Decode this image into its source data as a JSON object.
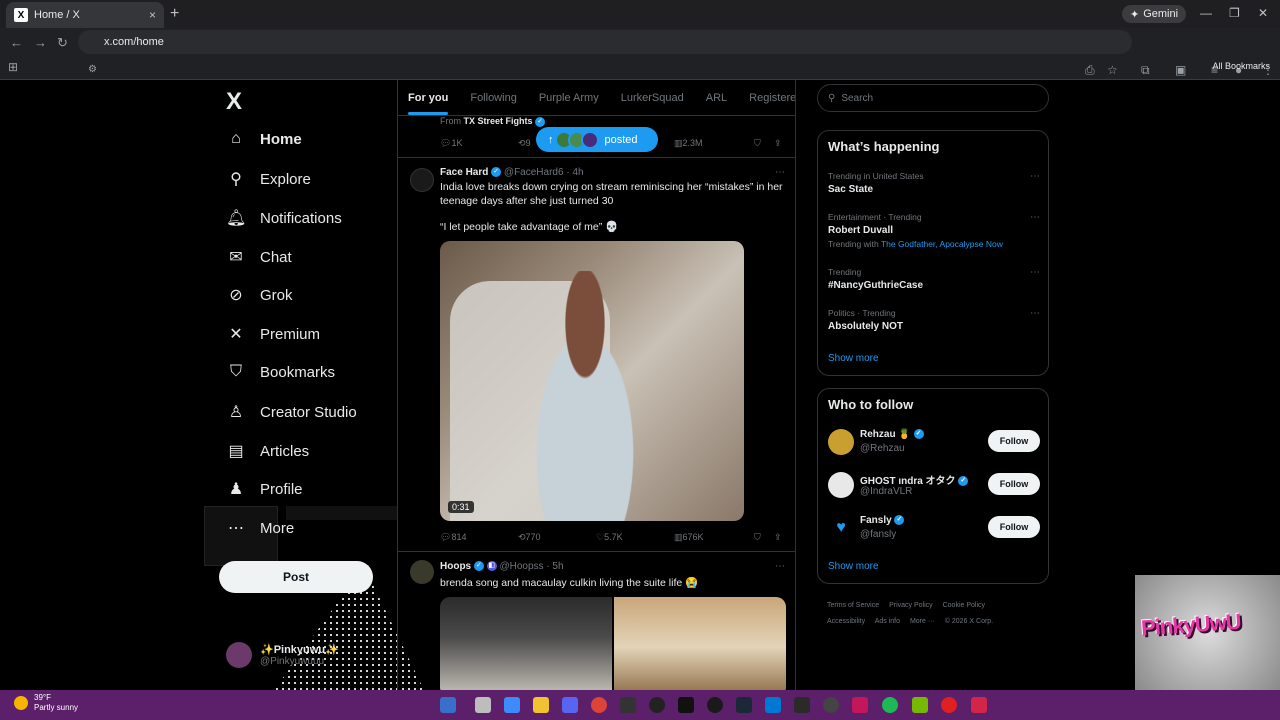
{
  "browser": {
    "tab_title": "Home / X",
    "tab_favicon": "X",
    "tab_close": "×",
    "new_tab": "+",
    "gemini_label": "Gemini",
    "url": "x.com/home",
    "all_bookmarks": "All Bookmarks"
  },
  "nav": {
    "logo": "X",
    "items": [
      {
        "label": "Home",
        "icon": "home-icon",
        "glyph": "⌂"
      },
      {
        "label": "Explore",
        "icon": "search-icon",
        "glyph": "⚲"
      },
      {
        "label": "Notifications",
        "icon": "bell-icon",
        "glyph": "🔔︎"
      },
      {
        "label": "Chat",
        "icon": "mail-icon",
        "glyph": "✉"
      },
      {
        "label": "Grok",
        "icon": "grok-icon",
        "glyph": "⊘"
      },
      {
        "label": "Premium",
        "icon": "x-icon",
        "glyph": "✕"
      },
      {
        "label": "Bookmarks",
        "icon": "bookmark-icon",
        "glyph": "⛉"
      },
      {
        "label": "Creator Studio",
        "icon": "creator-icon",
        "glyph": "♙"
      },
      {
        "label": "Articles",
        "icon": "articles-icon",
        "glyph": "▤"
      },
      {
        "label": "Profile",
        "icon": "profile-icon",
        "glyph": "♟"
      },
      {
        "label": "More",
        "icon": "more-icon",
        "glyph": "⋯"
      }
    ],
    "post_button": "Post",
    "account": {
      "name": "✨Pinkyuwu✨",
      "handle": "@Pinkyuwuuu"
    }
  },
  "feed": {
    "tabs": [
      "For you",
      "Following",
      "Purple Army",
      "LurkerSquad",
      "ARL",
      "Registered Fle"
    ],
    "prev_tweet": {
      "from_label": "From",
      "from_name": "TX Street Fights",
      "replies": "1K",
      "retweets": "9",
      "views": "2.3M"
    },
    "new_posts_pill": "posted",
    "tweet1": {
      "name": "Face Hard",
      "handle": "@FaceHard6",
      "time": "4h",
      "text": "India love breaks down crying on stream reminiscing her “mistakes” in her teenage days after she just turned 30",
      "quote": "“I let people take advantage of me” 💀",
      "duration": "0:31",
      "replies": "814",
      "retweets": "770",
      "likes": "5.7K",
      "views": "676K"
    },
    "tweet2": {
      "name": "Hoops",
      "handle": "@Hoopss",
      "time": "5h",
      "text": "brenda song and macaulay culkin living the suite life 😭"
    }
  },
  "sidebar": {
    "search_placeholder": "Search",
    "whats_happening": "What’s happening",
    "trends": [
      {
        "context": "Trending in United States",
        "name": "Sac State",
        "sub": ""
      },
      {
        "context": "Entertainment · Trending",
        "name": "Robert Duvall",
        "sub": "Trending with",
        "sub_links": "The Godfather, Apocalypse Now"
      },
      {
        "context": "Trending",
        "name": "#NancyGuthrieCase",
        "sub": ""
      },
      {
        "context": "Politics · Trending",
        "name": "Absolutely NOT",
        "sub": ""
      }
    ],
    "show_more": "Show more",
    "who_to_follow": "Who to follow",
    "follow_suggestions": [
      {
        "name": "Rehzau 🍍",
        "handle": "@Rehzau",
        "button": "Follow"
      },
      {
        "name": "GHOST ındra オタク",
        "handle": "@IndraVLR",
        "button": "Follow"
      },
      {
        "name": "Fansly",
        "handle": "@fansly",
        "button": "Follow"
      }
    ],
    "show_more_2": "Show more",
    "footer": [
      "Terms of Service",
      "Privacy Policy",
      "Cookie Policy",
      "Accessibility",
      "Ads info",
      "More ···",
      "© 2026 X Corp."
    ]
  },
  "overlay": {
    "cam_text": "PinkyUwU"
  },
  "taskbar": {
    "temp": "39°F",
    "condition": "Partly sunny"
  },
  "colors": {
    "accent": "#1d9bf0",
    "taskbar": "#5c1f6a"
  }
}
